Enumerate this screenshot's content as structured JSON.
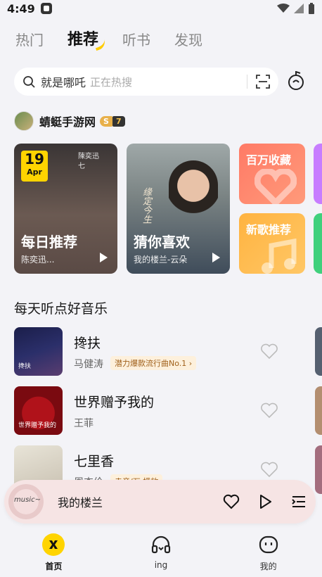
{
  "status_bar": {
    "time": "4:49"
  },
  "top_tabs": [
    {
      "label": "热门",
      "active": false
    },
    {
      "label": "推荐",
      "active": true
    },
    {
      "label": "听书",
      "active": false
    },
    {
      "label": "发现",
      "active": false
    }
  ],
  "search": {
    "query": "就是哪吒",
    "hint": "正在热搜"
  },
  "channel": {
    "name": "蜻蜓手游网",
    "level_letter": "S",
    "level_number": "7"
  },
  "cards": {
    "daily": {
      "title": "每日推荐",
      "subtitle": "陈奕迅...",
      "date_day": "19",
      "date_month": "Apr",
      "art_text": "陳奕迅 七"
    },
    "guess": {
      "title": "猜你喜欢",
      "subtitle": "我的楼兰-云朵",
      "art_text": "缘定今生"
    },
    "favorites": {
      "title": "百万收藏"
    },
    "new_songs": {
      "title": "新歌推荐"
    }
  },
  "section": {
    "title": "每天听点好音乐"
  },
  "songs": [
    {
      "title": "搀扶",
      "artist": "马健涛",
      "tag": "潜力爆款流行曲No.1 ›",
      "cover_text": "搀扶"
    },
    {
      "title": "世界赠予我的",
      "artist": "王菲",
      "tag": "",
      "cover_text": "世界赠予我的"
    },
    {
      "title": "七里香",
      "artist": "周杰伦",
      "tag": "走音/万·播放",
      "cover_text": ""
    }
  ],
  "player": {
    "title": "我的楼兰",
    "cover_text": "music~"
  },
  "bottom_nav": [
    {
      "label": "首页",
      "icon": "home-logo-icon",
      "active": true
    },
    {
      "label": "ing",
      "icon": "headphones-icon",
      "active": false
    },
    {
      "label": "我的",
      "icon": "smile-face-icon",
      "active": false
    }
  ],
  "colors": {
    "accent": "#ffd400",
    "background": "#f3f3f7",
    "player_bg": "#f6e4e4"
  }
}
